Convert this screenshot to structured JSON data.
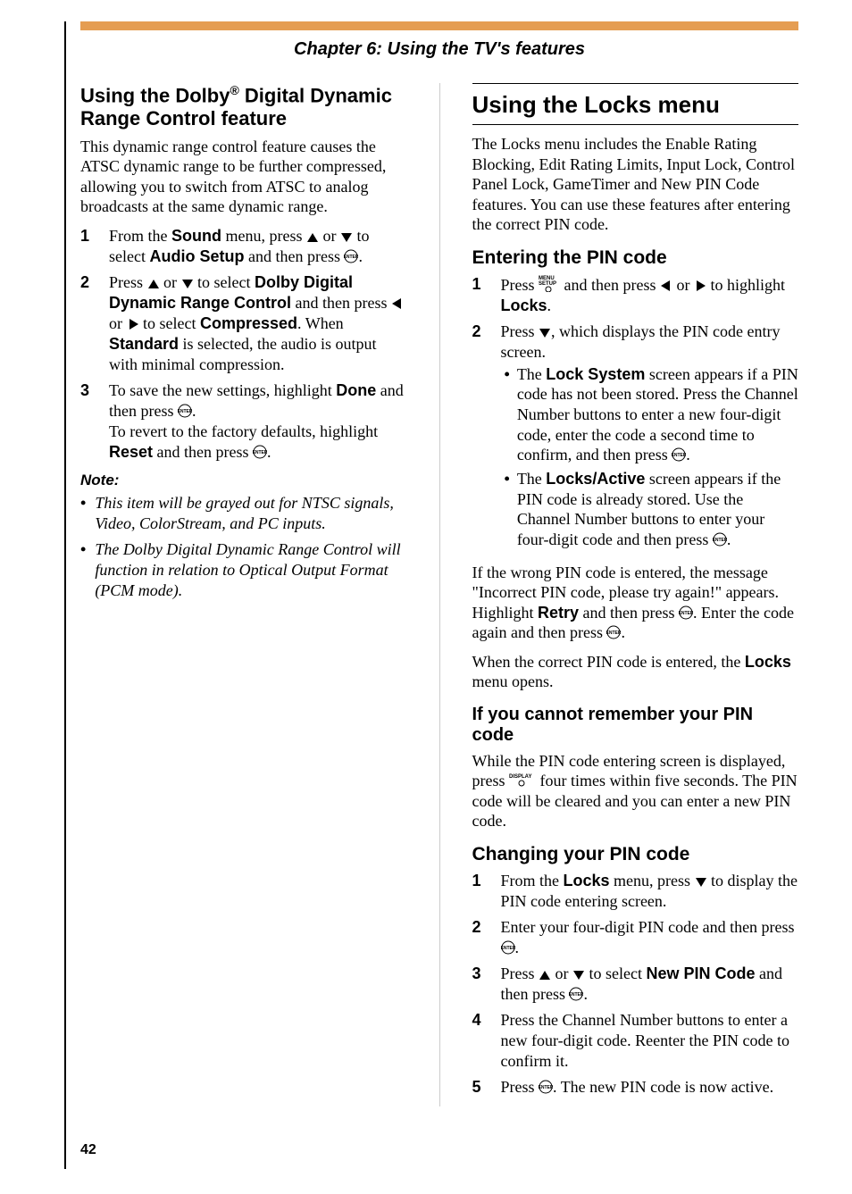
{
  "chapter_title": "Chapter 6: Using the TV's features",
  "page_number": "42",
  "left": {
    "heading_pre": "Using the Dolby",
    "heading_reg": "®",
    "heading_post": " Digital Dynamic Range Control feature",
    "intro": "This dynamic range control feature causes the ATSC dynamic range to be further compressed, allowing you to switch from ATSC to analog broadcasts at the same dynamic range.",
    "s1a": "From the ",
    "s1b": "Sound",
    "s1c": " menu, press ",
    "s1d": " or ",
    "s1e": " to select ",
    "s1f": "Audio Setup",
    "s1g": " and then press ",
    "s1h": ".",
    "s2a": "Press ",
    "s2b": " or ",
    "s2c": " to select ",
    "s2d": "Dolby Digital Dynamic Range Control",
    "s2e": " and then press ",
    "s2f": " or ",
    "s2g": " to select ",
    "s2h": "Compressed",
    "s2i": ". When ",
    "s2j": "Standard",
    "s2k": " is selected, the audio is output with minimal compression.",
    "s3a": "To save the new settings, highlight ",
    "s3b": "Done",
    "s3c": " and then press ",
    "s3d": ".",
    "s3e": "To revert to the factory defaults, highlight ",
    "s3f": "Reset",
    "s3g": " and then press ",
    "s3h": ".",
    "note_heading": "Note:",
    "note1": "This item will be grayed out for NTSC signals, Video, ColorStream, and PC inputs.",
    "note2": "The Dolby Digital Dynamic Range Control will function in relation to Optical Output Format (PCM mode)."
  },
  "right": {
    "heading": "Using the Locks menu",
    "intro": "The Locks menu includes the Enable Rating Blocking, Edit Rating Limits, Input Lock, Control Panel Lock, GameTimer and New PIN Code features. You can use these features after entering the correct PIN code.",
    "h_enter": "Entering the PIN code",
    "e1a": "Press ",
    "e1b": " and then press ",
    "e1c": " or ",
    "e1d": " to highlight ",
    "e1e": "Locks",
    "e1f": ".",
    "e2a": "Press ",
    "e2b": ", which displays the PIN code entry screen.",
    "e2_b1a": "The ",
    "e2_b1b": "Lock System",
    "e2_b1c": " screen appears if a PIN code has not been stored. Press the Channel Number buttons to enter a new four-digit code, enter the code a second time to confirm, and then press ",
    "e2_b1d": ".",
    "e2_b2a": "The ",
    "e2_b2b": "Locks/Active",
    "e2_b2c": " screen appears if the PIN code is already stored. Use the Channel Number buttons to enter your four-digit code and then press ",
    "e2_b2d": ".",
    "wrong_a": "If the wrong PIN code is entered, the message \"Incorrect PIN code, please try again!\" appears. Highlight ",
    "wrong_b": "Retry",
    "wrong_c": " and then press ",
    "wrong_d": ". Enter the code again and then press ",
    "wrong_e": ".",
    "correct_a": "When the correct PIN code is entered, the ",
    "correct_b": "Locks",
    "correct_c": " menu opens.",
    "h_forgot": "If you cannot remember your PIN code",
    "forgot_a": "While the PIN code entering screen is displayed, press ",
    "forgot_b": " four times within five seconds. The PIN code will be cleared and you can enter a new PIN code.",
    "h_change": "Changing your PIN code",
    "c1a": "From the ",
    "c1b": "Locks",
    "c1c": " menu, press ",
    "c1d": " to display the PIN code entering screen.",
    "c2a": "Enter your four-digit PIN code and then press ",
    "c2b": ".",
    "c3a": "Press ",
    "c3b": " or ",
    "c3c": " to select ",
    "c3d": "New PIN Code",
    "c3e": " and then press ",
    "c3f": ".",
    "c4": "Press the Channel Number buttons to enter a new four-digit code. Reenter the PIN code to confirm it.",
    "c5a": "Press ",
    "c5b": ". The new PIN code is now active."
  },
  "steps": {
    "n1": "1",
    "n2": "2",
    "n3": "3",
    "n4": "4",
    "n5": "5"
  }
}
